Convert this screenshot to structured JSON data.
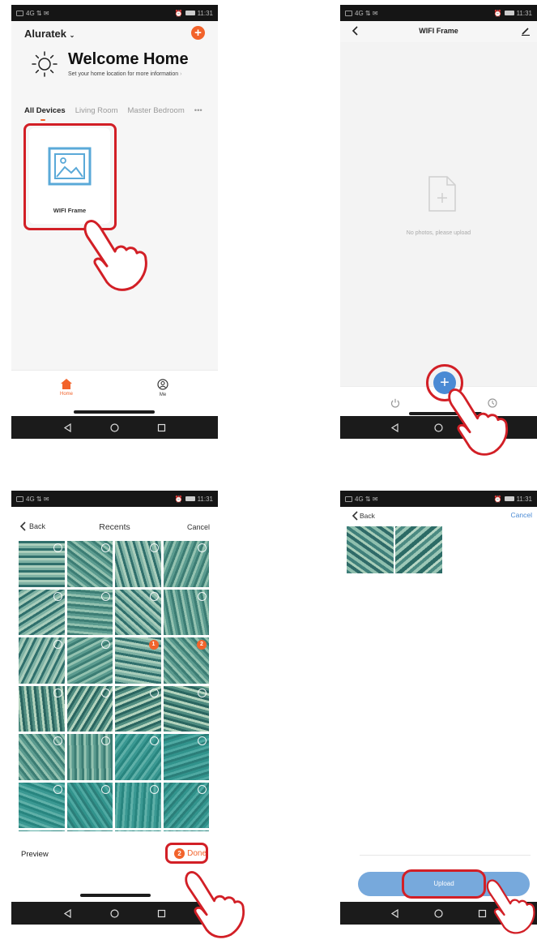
{
  "status_bar": {
    "left": "4G ⇅ ✉",
    "time": "11:31"
  },
  "screen1": {
    "home_name": "Aluratek",
    "welcome_title": "Welcome Home",
    "welcome_subtitle": "Set your home location for more information",
    "tabs": [
      "All Devices",
      "Living Room",
      "Master Bedroom"
    ],
    "more": "•••",
    "device_label": "WIFI Frame",
    "bottom_tabs": [
      {
        "label": "Home"
      },
      {
        "label": "Me"
      }
    ],
    "colors": {
      "accent": "#f2632b",
      "highlight": "#d21f26",
      "device_icon": "#5aa9d8"
    }
  },
  "screen2": {
    "title": "WIFI Frame",
    "empty_message": "No photos, please upload",
    "add_button": "+",
    "colors": {
      "fab": "#4a8ad4"
    }
  },
  "screen3": {
    "back": "Back",
    "title": "Recents",
    "cancel": "Cancel",
    "selected_badges": [
      "1",
      "2"
    ],
    "preview": "Preview",
    "done_count": "2",
    "done": "Done"
  },
  "screen4": {
    "back": "Back",
    "cancel": "Cancel",
    "upload": "Upload",
    "colors": {
      "upload_button": "#77a9dc"
    }
  }
}
